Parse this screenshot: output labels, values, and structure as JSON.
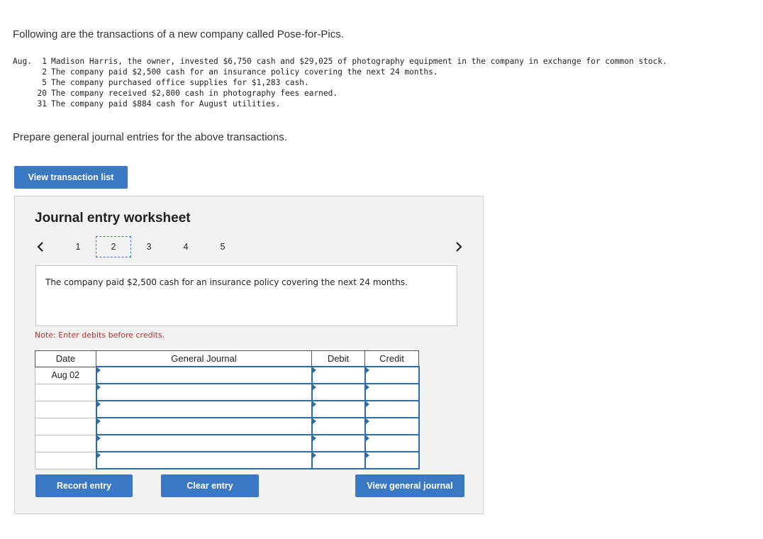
{
  "intro": "Following are the transactions of a new company called Pose-for-Pics.",
  "transactions": [
    {
      "month": "Aug.",
      "day": "1",
      "text": "Madison Harris, the owner, invested $6,750 cash and $29,025 of photography equipment in the company in exchange for common stock."
    },
    {
      "month": "",
      "day": "2",
      "text": "The company paid $2,500 cash for an insurance policy covering the next 24 months."
    },
    {
      "month": "",
      "day": "5",
      "text": "The company purchased office supplies for $1,283 cash."
    },
    {
      "month": "",
      "day": "20",
      "text": "The company received $2,800 cash in photography fees earned."
    },
    {
      "month": "",
      "day": "31",
      "text": "The company paid $884 cash for August utilities."
    }
  ],
  "instruction": "Prepare general journal entries for the above transactions.",
  "view_transaction_list": "View transaction list",
  "worksheet": {
    "title": "Journal entry worksheet",
    "prev_icon": "chevron-left-icon",
    "next_icon": "chevron-right-icon",
    "pages": [
      "1",
      "2",
      "3",
      "4",
      "5"
    ],
    "active_page": "2",
    "description": "The company paid $2,500 cash for an insurance policy covering the next 24 months.",
    "note": "Note: Enter debits before credits.",
    "columns": {
      "date": "Date",
      "journal": "General Journal",
      "debit": "Debit",
      "credit": "Credit"
    },
    "rows": [
      {
        "date": "Aug 02"
      },
      {
        "date": ""
      },
      {
        "date": ""
      },
      {
        "date": ""
      },
      {
        "date": ""
      },
      {
        "date": ""
      }
    ],
    "buttons": {
      "record": "Record entry",
      "clear": "Clear entry",
      "view_journal": "View general journal"
    }
  },
  "colors": {
    "accent": "#3a78c3",
    "note": "#aa3333"
  }
}
